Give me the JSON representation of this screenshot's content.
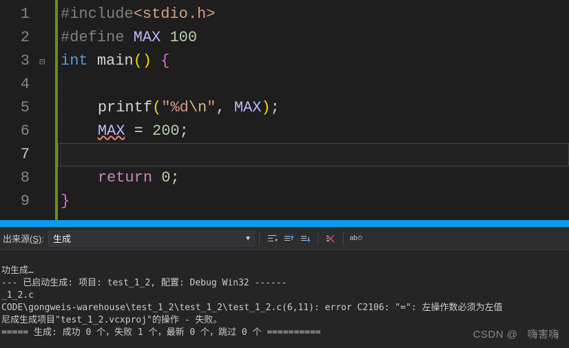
{
  "code": {
    "lineNumbers": [
      "1",
      "2",
      "3",
      "4",
      "5",
      "6",
      "7",
      "8",
      "9"
    ],
    "lines": {
      "l1": {
        "hash": "#",
        "include": "include",
        "path": "<stdio.h>"
      },
      "l2": {
        "hash": "#",
        "define": "define ",
        "macro": "MAX",
        "space": " ",
        "value": "100"
      },
      "l3": {
        "kw": "int",
        "space": " ",
        "fn": "main",
        "op": "(",
        "cp": ")",
        "sp2": " ",
        "ob": "{"
      },
      "l5": {
        "fn": "printf",
        "op": "(",
        "str1": "\"",
        "strbody": "%d",
        "esc": "\\n",
        "str2": "\"",
        "comma": ", ",
        "macro": "MAX",
        "cp": ")",
        "semi": ";"
      },
      "l6": {
        "macro": "MAX",
        "rest": " = ",
        "num": "200",
        "semi": ";"
      },
      "l8": {
        "ret": "return",
        "space": " ",
        "num": "0",
        "semi": ";"
      },
      "l9": {
        "cb": "}"
      }
    }
  },
  "output": {
    "sourceLabelPrefix": "出来源",
    "sourceLabelHotkey": "(S)",
    "sourceLabelSuffix": ":",
    "dropdownValue": "生成",
    "lines": [
      "功生成…",
      "--- 已启动生成: 项目: test_1_2, 配置: Debug Win32 ------",
      "_1_2.c",
      "CODE\\gongweis-warehouse\\test_1_2\\test_1_2\\test_1_2.c(6,11): error C2106: \"=\": 左操作数必须为左值",
      "尼成生成项目\"test_1_2.vcxproj\"的操作 - 失败。",
      "===== 生成: 成功 0 个，失败 1 个，最新 0 个，跳过 0 个 =========="
    ]
  },
  "watermark": {
    "prefix": "CSDN @",
    "name": "嗨害嗨"
  }
}
